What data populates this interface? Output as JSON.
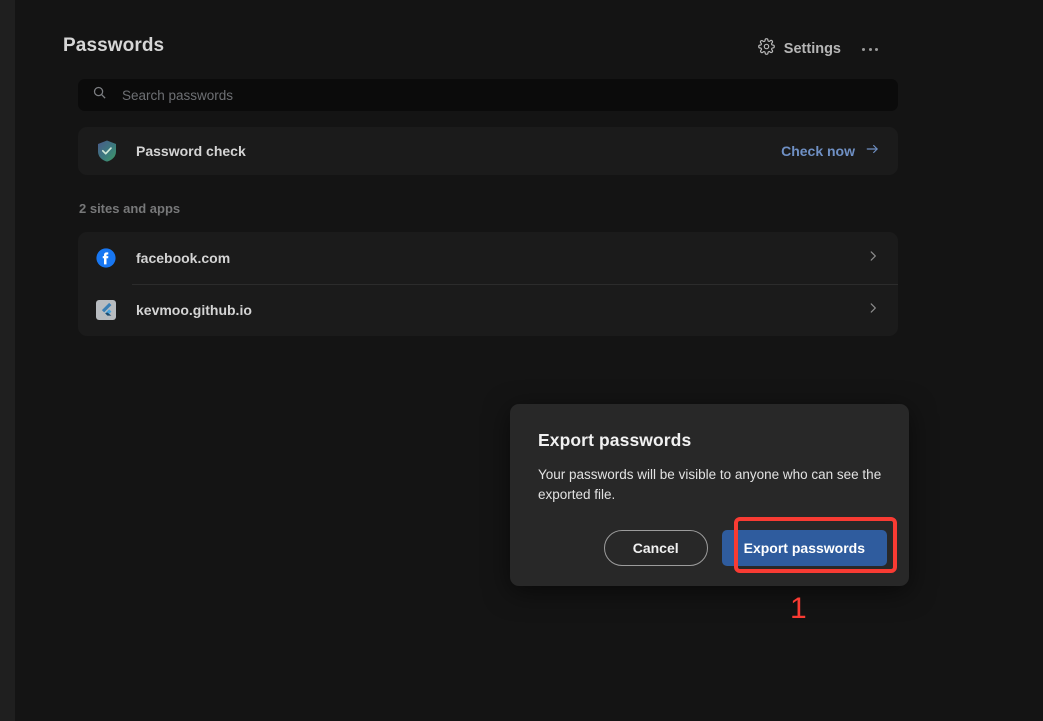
{
  "header": {
    "title": "Passwords",
    "settings_label": "Settings",
    "settings_icon": "gear-icon",
    "more_icon": "more-horizontal-icon"
  },
  "search": {
    "placeholder": "Search passwords",
    "value": "",
    "icon": "search-icon"
  },
  "password_check": {
    "label": "Password check",
    "action_label": "Check now",
    "icon": "shield-check-icon",
    "arrow_icon": "arrow-right-icon",
    "link_color": "#6f90c4"
  },
  "sites_section": {
    "label": "2 sites and apps",
    "items": [
      {
        "name": "facebook.com",
        "icon": "facebook-icon",
        "icon_color": "#1877f2",
        "chevron_icon": "chevron-right-icon"
      },
      {
        "name": "kevmoo.github.io",
        "icon": "flutter-icon",
        "icon_color": "#4a9fd4",
        "chevron_icon": "chevron-right-icon"
      }
    ]
  },
  "dialog": {
    "title": "Export passwords",
    "body": "Your passwords will be visible to anyone who can see the exported file.",
    "cancel_label": "Cancel",
    "confirm_label": "Export passwords",
    "confirm_color": "#2f5c9e"
  },
  "annotation": {
    "step_number": "1",
    "color": "#f93b33"
  }
}
